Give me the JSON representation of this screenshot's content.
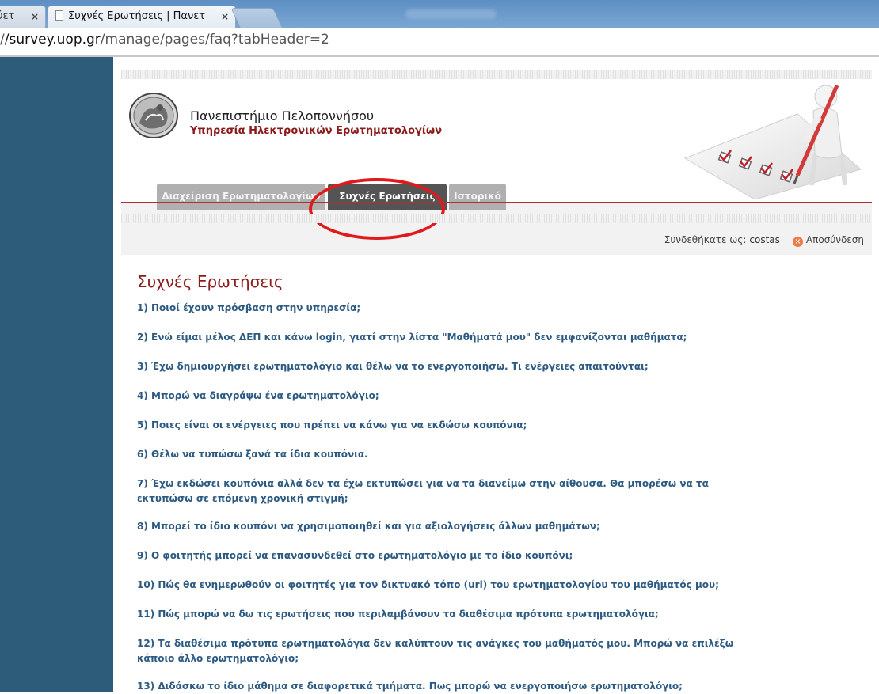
{
  "browser": {
    "tabs": [
      {
        "title": "ύετ",
        "close": "×"
      },
      {
        "title": "Συχνές Ερωτήσεις | Πανετ",
        "close": "×"
      }
    ],
    "url_prefix": "/",
    "url_host": "/survey.uop.gr",
    "url_path": "/manage/pages/faq?tabHeader=2"
  },
  "header": {
    "university": "Πανεπιστήμιο Πελοποννήσου",
    "service": "Υπηρεσία Ηλεκτρονικών Ερωτηματολογίων"
  },
  "nav": {
    "tabs": [
      {
        "label": "Διαχείριση Ερωτηματολογίων",
        "active": false
      },
      {
        "label": "Συχνές Ερωτήσεις",
        "active": true
      },
      {
        "label": "Ιστορικό",
        "active": false
      }
    ]
  },
  "userbar": {
    "logged_in_label": "Συνδεθήκατε ως:",
    "username": "costas",
    "logout_label": "Αποσύνδεση"
  },
  "faq": {
    "title": "Συχνές Ερωτήσεις",
    "items": [
      "1) Ποιοί έχουν πρόσβαση στην υπηρεσία;",
      "2) Ενώ είμαι μέλος ΔΕΠ και κάνω login, γιατί στην λίστα \"Μαθήματά μου\" δεν εμφανίζονται μαθήματα;",
      "3) Έχω δημιουργήσει ερωτηματολόγιο και θέλω να το ενεργοποιήσω. Τι ενέργειες απαιτούνται;",
      "4) Μπορώ να διαγράψω ένα ερωτηματολόγιο;",
      "5) Ποιες είναι οι ενέργειες που πρέπει να κάνω για να εκδώσω κουπόνια;",
      "6) Θέλω να τυπώσω ξανά τα ίδια κουπόνια.",
      "7) Έχω εκδώσει κουπόνια αλλά δεν τα έχω εκτυπώσει για να τα διανείμω στην αίθουσα. Θα μπορέσω να τα εκτυπώσω σε επόμενη χρονική στιγμή;",
      "8) Μπορεί το ίδιο κουπόνι να χρησιμοποιηθεί και για αξιολογήσεις άλλων μαθημάτων;",
      "9) Ο φοιτητής μπορεί να επανασυνδεθεί στο ερωτηματολόγιο με το ίδιο κουπόνι;",
      "10) Πώς θα ενημερωθούν οι φοιτητές για τον δικτυακό τόπο (url) του ερωτηματολογίου του μαθήματός μου;",
      "11) Πώς μπορώ να δω τις ερωτήσεις που περιλαμβάνουν τα διαθέσιμα πρότυπα ερωτηματολόγια;",
      "12) Τα διαθέσιμα πρότυπα ερωτηματολόγια δεν καλύπτουν τις ανάγκες του μαθήματός μου. Μπορώ να επιλέξω κάποιο άλλο ερωτηματολόγιο;",
      "13) Διδάσκω το ίδιο μάθημα σε διαφορετικά τμήματα. Πως μπορώ να ενεργοποιήσω ερωτηματολόγιο;"
    ]
  },
  "colors": {
    "left_band": "#2d5c7b",
    "faq_link": "#2d5a82",
    "title_red": "#8b1a1a",
    "highlight": "#e01a1a"
  }
}
